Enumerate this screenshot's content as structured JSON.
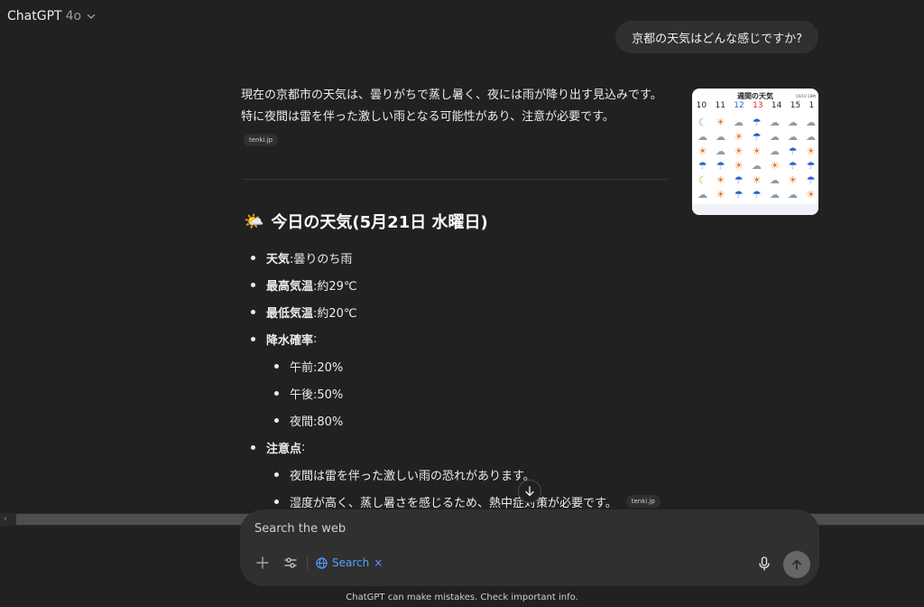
{
  "header": {
    "model": "ChatGPT",
    "version": "4o"
  },
  "user_message": "京都の天気はどんな感じですか?",
  "answer": {
    "intro": "現在の京都市の天気は、曇りがちで蒸し暑く、夜には雨が降り出す見込みです。特に夜間は雷を伴った激しい雨となる可能性があり、注意が必要です。",
    "source1": "tenki.jp",
    "heading_icon": "🌤️",
    "heading": "今日の天気(5月21日 水曜日)",
    "items": {
      "weather_label": "天気",
      "weather_value": ":曇りのち雨",
      "high_label": "最高気温",
      "high_value": ":約29℃",
      "low_label": "最低気温",
      "low_value": ":約20℃",
      "rain_label": "降水確率",
      "rain_colon": ":",
      "am": "午前:20%",
      "pm": "午後:50%",
      "night": "夜間:80%",
      "caution_label": "注意点",
      "caution_colon": ":",
      "caution1": "夜間は雷を伴った激しい雨の恐れがあります。",
      "caution2": "湿度が高く、蒸し暑さを感じるため、熱中症対策が必要です。",
      "source2": "tenki.jp"
    }
  },
  "thumbnail": {
    "title": "週間の天気",
    "date": "04/10 18時",
    "days": [
      "10",
      "11",
      "12",
      "13",
      "14",
      "15",
      "1"
    ],
    "day_colors": [
      "#222222",
      "#222222",
      "#1a6fd6",
      "#d62a2a",
      "#222222",
      "#222222",
      "#222222"
    ]
  },
  "composer": {
    "placeholder": "Search the web",
    "search_label": "Search",
    "search_close": "×"
  },
  "footer": "ChatGPT can make mistakes. Check important info."
}
